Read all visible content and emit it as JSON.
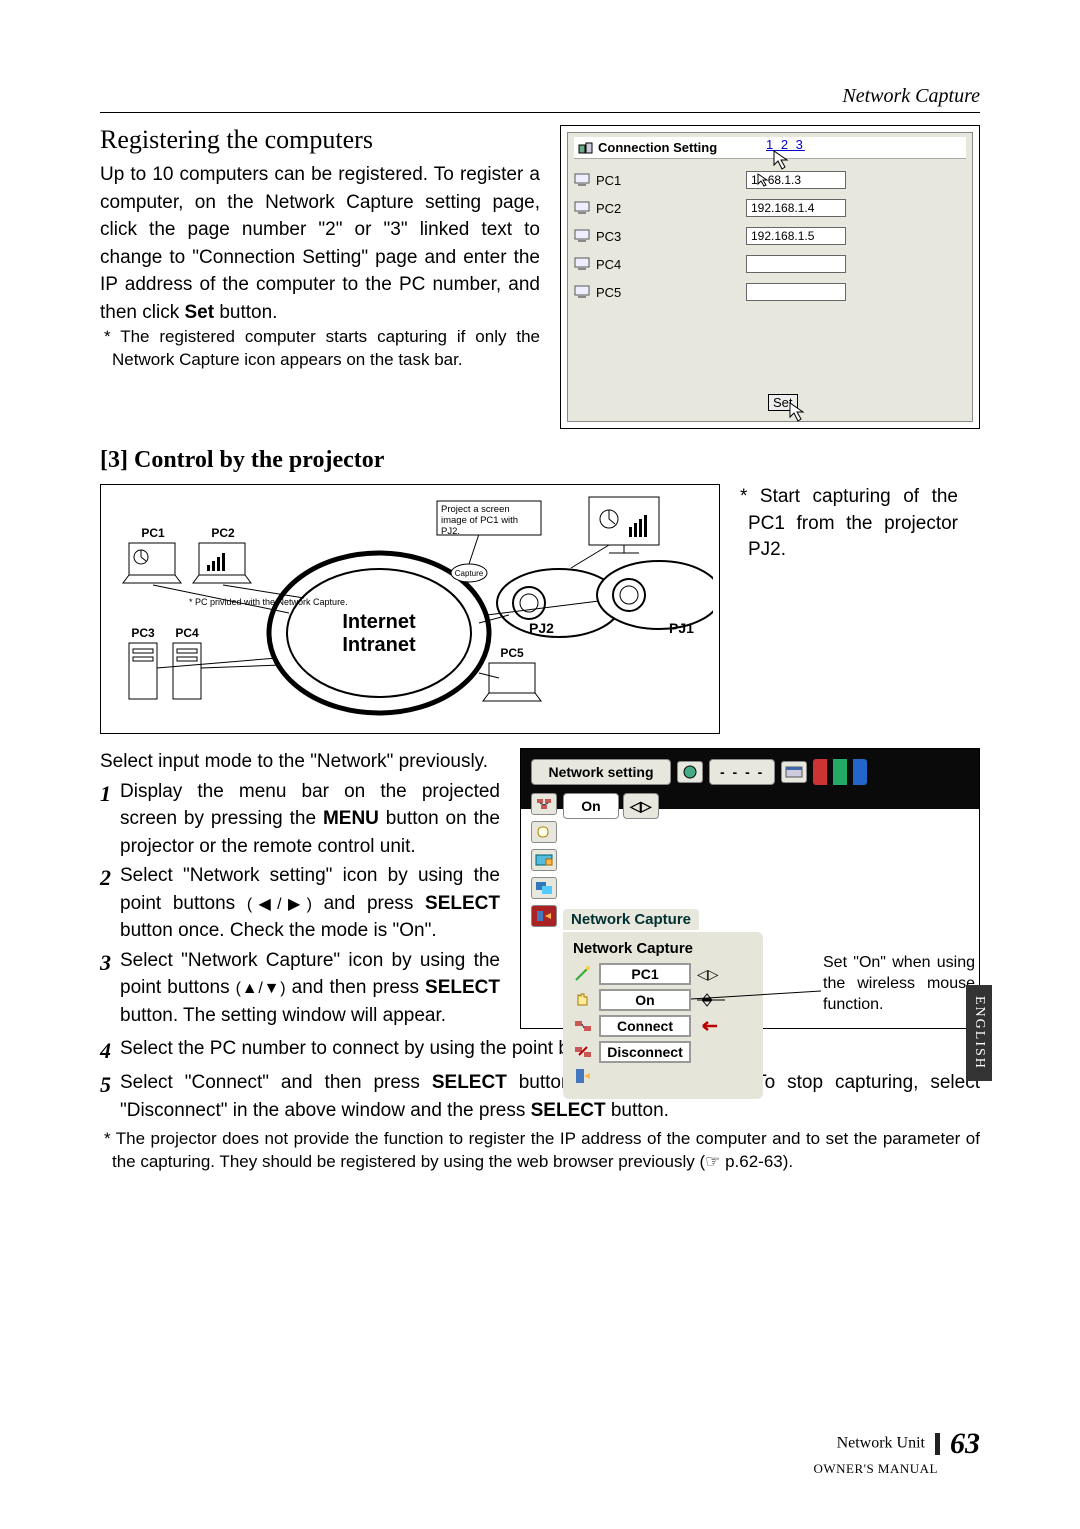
{
  "header": {
    "right": "Network Capture"
  },
  "section1": {
    "title": "Registering the computers",
    "body": "Up to 10 computers can be registered. To register a computer, on the Network Capture setting page, click the page number \"2\" or \"3\" linked text to change to \"Connection Setting\" page and enter the IP address of the computer to the PC number, and then click Set button.",
    "note": "* The registered computer starts capturing if only the Network Capture icon appears on the task bar."
  },
  "connection_panel": {
    "title": "Connection Setting",
    "pages": "1 2 3",
    "rows": [
      {
        "label": "PC1",
        "ip": "68.1.3"
      },
      {
        "label": "PC2",
        "ip": "192.168.1.4"
      },
      {
        "label": "PC3",
        "ip": "192.168.1.5"
      },
      {
        "label": "PC4",
        "ip": ""
      },
      {
        "label": "PC5",
        "ip": ""
      }
    ],
    "set_label": "Set"
  },
  "section2": {
    "title": "[3] Control by the projector",
    "diagram": {
      "pc1": "PC1",
      "pc2": "PC2",
      "pc3": "PC3",
      "pc4": "PC4",
      "pc5": "PC5",
      "pj1": "PJ1",
      "pj2": "PJ2",
      "center": "Internet\nIntranet",
      "bubble": "Project a screen image of PC1 with PJ2.",
      "capture": "Capture",
      "pc_note": "* PC privided with the Network Capture."
    },
    "side_note": "* Start capturing of the PC1 from the projector PJ2."
  },
  "section3": {
    "intro": "Select input mode to the \"Network\" previously.",
    "items": [
      "Display the menu bar on the projected screen by pressing the MENU button on the projector or the remote control unit.",
      "Select \"Network setting\" icon by using the point buttons (◀/▶) and press SELECT button once. Check the mode is \"On\".",
      "Select \"Network Capture\" icon by using the point buttons (▲/▼) and then press SELECT button. The setting window will appear.",
      "Select the PC number to connect by using the point buttons (◀/▶).",
      "Select \"Connect\" and then press SELECT button to start capturing. To stop capturing, select \"Disconnect\" in the above window and the press SELECT button."
    ],
    "footnote": "* The projector does not provide the function to register the IP address of the computer and to set the parameter of the capturing. They should be registered by using the web browser previously (☞ p.62-63)."
  },
  "menu_panel": {
    "top_label": "Network setting",
    "dashes": "- - - -",
    "on": "On",
    "nc_tab": "Network Capture",
    "nc_title": "Network Capture",
    "pc1": "PC1",
    "on2": "On",
    "connect": "Connect",
    "disconnect": "Disconnect",
    "callout": "Set \"On\" when using the wireless mouse function."
  },
  "side_tab": "ENGLISH",
  "footer": {
    "unit": "Network Unit",
    "page": "63",
    "manual": "OWNER'S MANUAL"
  }
}
